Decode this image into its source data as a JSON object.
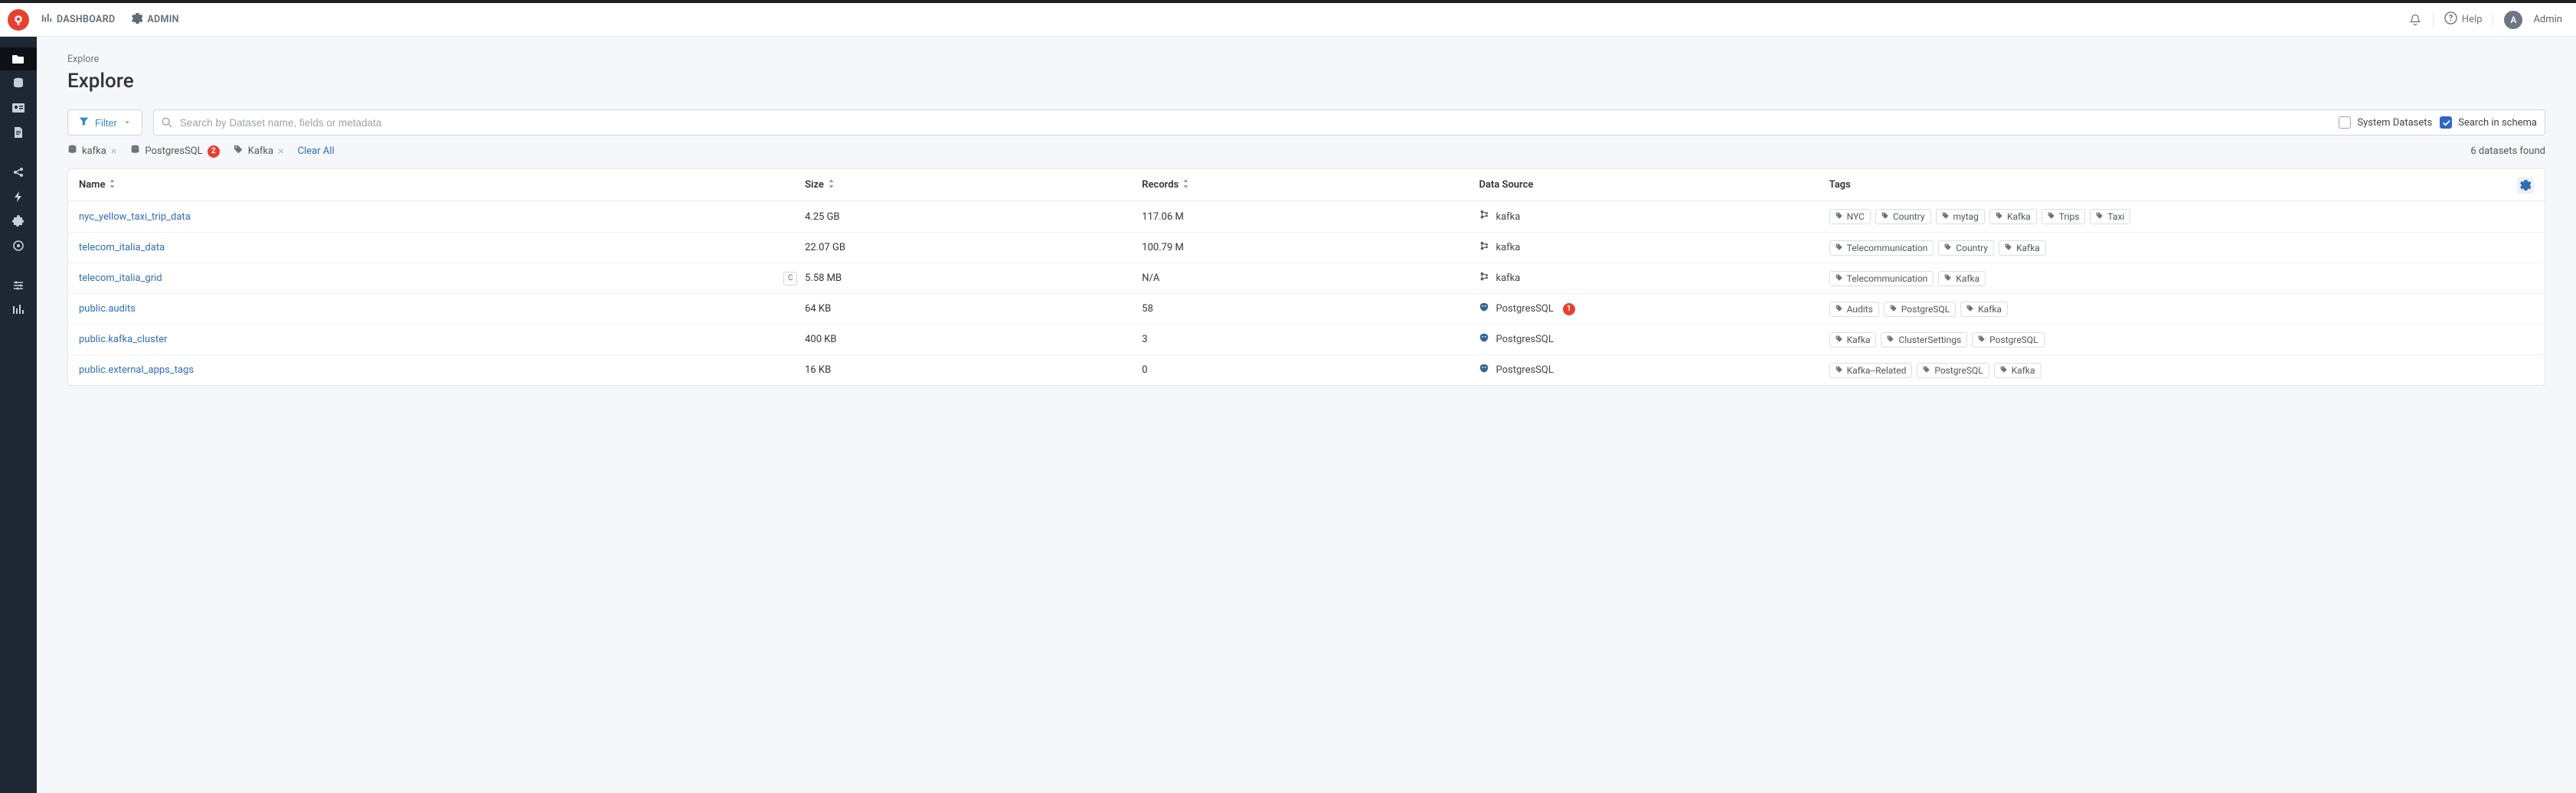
{
  "topbar": {
    "nav": {
      "dashboard": "DASHBOARD",
      "admin": "ADMIN"
    },
    "help": "Help",
    "user": {
      "initial": "A",
      "name": "Admin"
    }
  },
  "breadcrumb": "Explore",
  "page_title": "Explore",
  "filter": {
    "button_label": "Filter",
    "search_placeholder": "Search by Dataset name, fields or metadata",
    "system_datasets_label": "System Datasets",
    "system_datasets_checked": false,
    "search_in_schema_label": "Search in schema",
    "search_in_schema_checked": true
  },
  "chips": [
    {
      "icon": "database",
      "label": "kafka",
      "closable": true
    },
    {
      "icon": "database",
      "label": "PostgresSQL",
      "badge": "2"
    },
    {
      "icon": "tag",
      "label": "Kafka",
      "closable": true
    }
  ],
  "clear_all": "Clear All",
  "found_text": "6 datasets found",
  "columns": {
    "name": "Name",
    "size": "Size",
    "records": "Records",
    "datasource": "Data Source",
    "tags": "Tags"
  },
  "row_badge_1": "1",
  "pill_c": "C",
  "rows": [
    {
      "name": "nyc_yellow_taxi_trip_data",
      "size": "4.25 GB",
      "records": "117.06 M",
      "ds": {
        "type": "kafka",
        "label": "kafka"
      },
      "tags": [
        "NYC",
        "Country",
        "mytag",
        "Kafka",
        "Trips",
        "Taxi"
      ]
    },
    {
      "name": "telecom_italia_data",
      "size": "22.07 GB",
      "records": "100.79 M",
      "ds": {
        "type": "kafka",
        "label": "kafka"
      },
      "tags": [
        "Telecommunication",
        "Country",
        "Kafka"
      ]
    },
    {
      "name": "telecom_italia_grid",
      "pill": true,
      "size": "5.58 MB",
      "records": "N/A",
      "ds": {
        "type": "kafka",
        "label": "kafka"
      },
      "tags": [
        "Telecommunication",
        "Kafka"
      ]
    },
    {
      "name": "public.audits",
      "size": "64 KB",
      "records": "58",
      "ds": {
        "type": "postgres",
        "label": "PostgresSQL",
        "badge": true
      },
      "tags": [
        "Audits",
        "PostgreSQL",
        "Kafka"
      ]
    },
    {
      "name": "public.kafka_cluster",
      "size": "400 KB",
      "records": "3",
      "ds": {
        "type": "postgres",
        "label": "PostgresSQL"
      },
      "tags": [
        "Kafka",
        "ClusterSettings",
        "PostgreSQL"
      ]
    },
    {
      "name": "public.external_apps_tags",
      "size": "16 KB",
      "records": "0",
      "ds": {
        "type": "postgres",
        "label": "PostgresSQL"
      },
      "tags": [
        "Kafka--Related",
        "PostgreSQL",
        "Kafka"
      ]
    }
  ]
}
